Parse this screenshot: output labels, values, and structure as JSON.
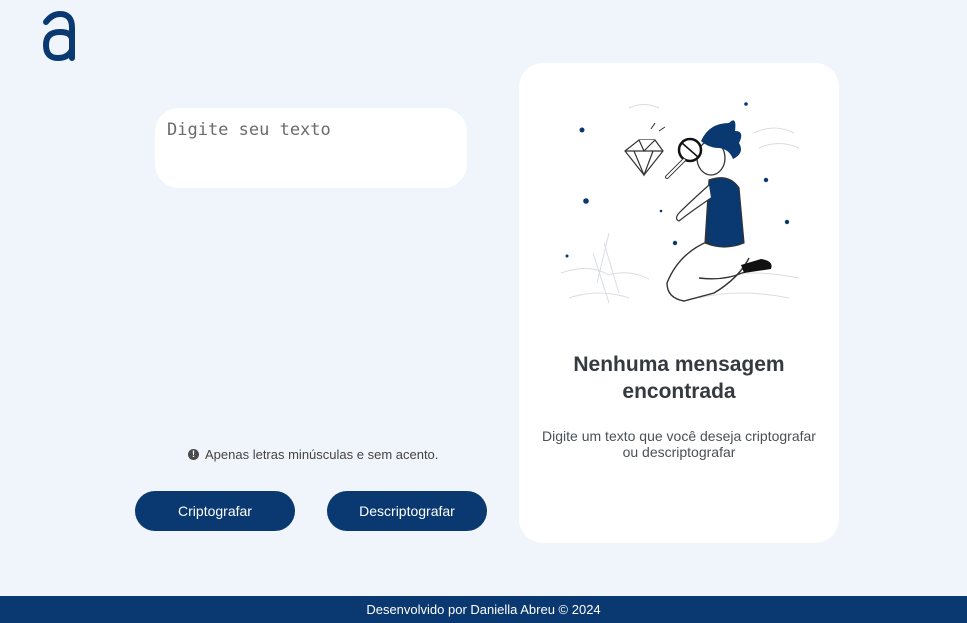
{
  "brand": {
    "logo_icon": "alura-a-logo",
    "color": "#0a3871"
  },
  "input": {
    "placeholder": "Digite seu texto",
    "value": ""
  },
  "hint": {
    "icon": "exclamation-circle-icon",
    "text": "Apenas letras minúsculas e sem acento."
  },
  "buttons": {
    "encrypt_label": "Criptografar",
    "decrypt_label": "Descriptografar"
  },
  "output": {
    "illustration": "person-with-magnifier-illustration",
    "title": "Nenhuma mensagem encontrada",
    "description": "Digite um texto que você deseja criptografar ou descriptografar"
  },
  "footer": {
    "text": "Desenvolvido por Daniella Abreu © 2024"
  },
  "colors": {
    "background": "#f0f4fb",
    "primary": "#0a3871",
    "panel": "#ffffff"
  }
}
